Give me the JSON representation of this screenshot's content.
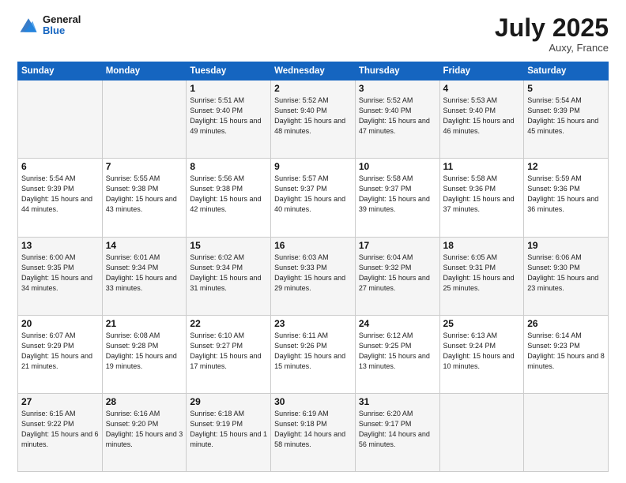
{
  "header": {
    "logo_general": "General",
    "logo_blue": "Blue",
    "month": "July 2025",
    "location": "Auxy, France"
  },
  "weekdays": [
    "Sunday",
    "Monday",
    "Tuesday",
    "Wednesday",
    "Thursday",
    "Friday",
    "Saturday"
  ],
  "weeks": [
    [
      {
        "day": "",
        "info": ""
      },
      {
        "day": "",
        "info": ""
      },
      {
        "day": "1",
        "info": "Sunrise: 5:51 AM\nSunset: 9:40 PM\nDaylight: 15 hours and 49 minutes."
      },
      {
        "day": "2",
        "info": "Sunrise: 5:52 AM\nSunset: 9:40 PM\nDaylight: 15 hours and 48 minutes."
      },
      {
        "day": "3",
        "info": "Sunrise: 5:52 AM\nSunset: 9:40 PM\nDaylight: 15 hours and 47 minutes."
      },
      {
        "day": "4",
        "info": "Sunrise: 5:53 AM\nSunset: 9:40 PM\nDaylight: 15 hours and 46 minutes."
      },
      {
        "day": "5",
        "info": "Sunrise: 5:54 AM\nSunset: 9:39 PM\nDaylight: 15 hours and 45 minutes."
      }
    ],
    [
      {
        "day": "6",
        "info": "Sunrise: 5:54 AM\nSunset: 9:39 PM\nDaylight: 15 hours and 44 minutes."
      },
      {
        "day": "7",
        "info": "Sunrise: 5:55 AM\nSunset: 9:38 PM\nDaylight: 15 hours and 43 minutes."
      },
      {
        "day": "8",
        "info": "Sunrise: 5:56 AM\nSunset: 9:38 PM\nDaylight: 15 hours and 42 minutes."
      },
      {
        "day": "9",
        "info": "Sunrise: 5:57 AM\nSunset: 9:37 PM\nDaylight: 15 hours and 40 minutes."
      },
      {
        "day": "10",
        "info": "Sunrise: 5:58 AM\nSunset: 9:37 PM\nDaylight: 15 hours and 39 minutes."
      },
      {
        "day": "11",
        "info": "Sunrise: 5:58 AM\nSunset: 9:36 PM\nDaylight: 15 hours and 37 minutes."
      },
      {
        "day": "12",
        "info": "Sunrise: 5:59 AM\nSunset: 9:36 PM\nDaylight: 15 hours and 36 minutes."
      }
    ],
    [
      {
        "day": "13",
        "info": "Sunrise: 6:00 AM\nSunset: 9:35 PM\nDaylight: 15 hours and 34 minutes."
      },
      {
        "day": "14",
        "info": "Sunrise: 6:01 AM\nSunset: 9:34 PM\nDaylight: 15 hours and 33 minutes."
      },
      {
        "day": "15",
        "info": "Sunrise: 6:02 AM\nSunset: 9:34 PM\nDaylight: 15 hours and 31 minutes."
      },
      {
        "day": "16",
        "info": "Sunrise: 6:03 AM\nSunset: 9:33 PM\nDaylight: 15 hours and 29 minutes."
      },
      {
        "day": "17",
        "info": "Sunrise: 6:04 AM\nSunset: 9:32 PM\nDaylight: 15 hours and 27 minutes."
      },
      {
        "day": "18",
        "info": "Sunrise: 6:05 AM\nSunset: 9:31 PM\nDaylight: 15 hours and 25 minutes."
      },
      {
        "day": "19",
        "info": "Sunrise: 6:06 AM\nSunset: 9:30 PM\nDaylight: 15 hours and 23 minutes."
      }
    ],
    [
      {
        "day": "20",
        "info": "Sunrise: 6:07 AM\nSunset: 9:29 PM\nDaylight: 15 hours and 21 minutes."
      },
      {
        "day": "21",
        "info": "Sunrise: 6:08 AM\nSunset: 9:28 PM\nDaylight: 15 hours and 19 minutes."
      },
      {
        "day": "22",
        "info": "Sunrise: 6:10 AM\nSunset: 9:27 PM\nDaylight: 15 hours and 17 minutes."
      },
      {
        "day": "23",
        "info": "Sunrise: 6:11 AM\nSunset: 9:26 PM\nDaylight: 15 hours and 15 minutes."
      },
      {
        "day": "24",
        "info": "Sunrise: 6:12 AM\nSunset: 9:25 PM\nDaylight: 15 hours and 13 minutes."
      },
      {
        "day": "25",
        "info": "Sunrise: 6:13 AM\nSunset: 9:24 PM\nDaylight: 15 hours and 10 minutes."
      },
      {
        "day": "26",
        "info": "Sunrise: 6:14 AM\nSunset: 9:23 PM\nDaylight: 15 hours and 8 minutes."
      }
    ],
    [
      {
        "day": "27",
        "info": "Sunrise: 6:15 AM\nSunset: 9:22 PM\nDaylight: 15 hours and 6 minutes."
      },
      {
        "day": "28",
        "info": "Sunrise: 6:16 AM\nSunset: 9:20 PM\nDaylight: 15 hours and 3 minutes."
      },
      {
        "day": "29",
        "info": "Sunrise: 6:18 AM\nSunset: 9:19 PM\nDaylight: 15 hours and 1 minute."
      },
      {
        "day": "30",
        "info": "Sunrise: 6:19 AM\nSunset: 9:18 PM\nDaylight: 14 hours and 58 minutes."
      },
      {
        "day": "31",
        "info": "Sunrise: 6:20 AM\nSunset: 9:17 PM\nDaylight: 14 hours and 56 minutes."
      },
      {
        "day": "",
        "info": ""
      },
      {
        "day": "",
        "info": ""
      }
    ]
  ]
}
